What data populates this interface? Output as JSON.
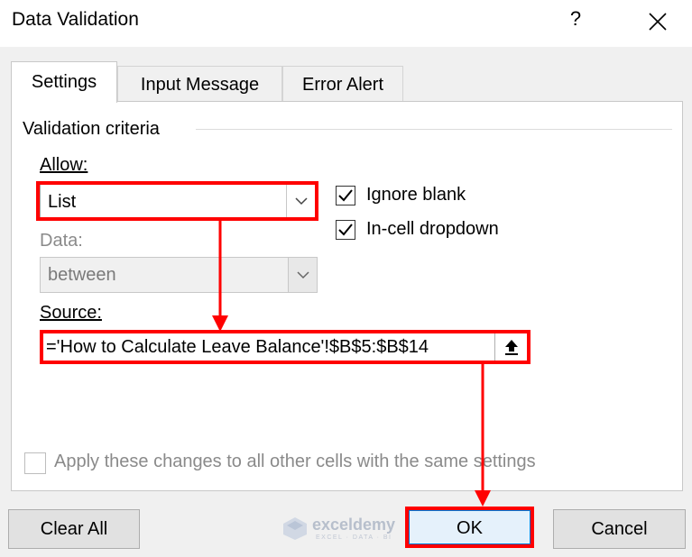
{
  "window": {
    "title": "Data Validation",
    "help_label": "?",
    "close_icon": "close-icon"
  },
  "tabs": [
    {
      "label": "Settings",
      "active": true
    },
    {
      "label": "Input Message",
      "active": false
    },
    {
      "label": "Error Alert",
      "active": false
    }
  ],
  "validation": {
    "group_label": "Validation criteria",
    "allow": {
      "label": "Allow:",
      "value": "List"
    },
    "data": {
      "label": "Data:",
      "value": "between",
      "disabled": true
    },
    "source": {
      "label": "Source:",
      "value": "='How to Calculate Leave Balance'!$B$5:$B$14"
    },
    "ignore_blank": {
      "label": "Ignore blank",
      "checked": true
    },
    "in_cell_dropdown": {
      "label": "In-cell dropdown",
      "checked": true
    }
  },
  "apply_all": {
    "label": "Apply these changes to all other cells with the same settings",
    "checked": false,
    "disabled": true
  },
  "buttons": {
    "clear_all": "Clear All",
    "ok": "OK",
    "cancel": "Cancel"
  },
  "watermark": {
    "name": "exceldemy",
    "tagline": "EXCEL · DATA · BI"
  },
  "colors": {
    "highlight": "#ff0000",
    "accent": "#0078d7",
    "dialog_bg": "#f0f0f0",
    "panel_bg": "#ffffff"
  }
}
